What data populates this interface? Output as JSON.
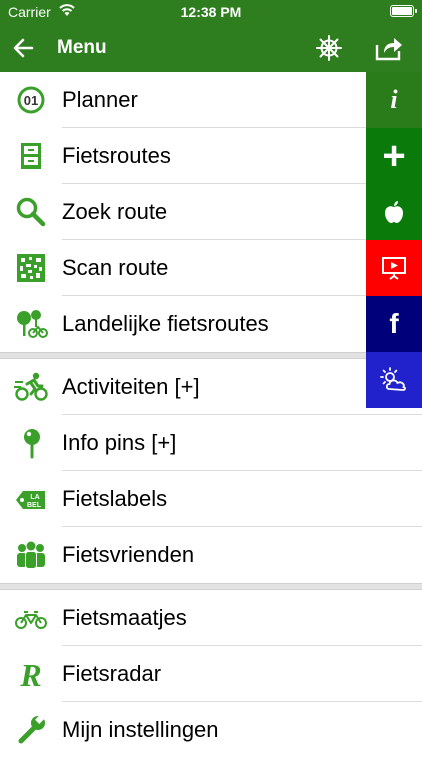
{
  "status": {
    "carrier": "Carrier",
    "time": "12:38 PM"
  },
  "header": {
    "title": "Menu"
  },
  "menu": {
    "items": [
      {
        "label": "Planner",
        "icon": "planner-01-icon"
      },
      {
        "label": "Fietsroutes",
        "icon": "cabinet-icon"
      },
      {
        "label": "Zoek route",
        "icon": "magnifier-icon"
      },
      {
        "label": "Scan route",
        "icon": "qr-code-icon"
      },
      {
        "label": "Landelijke fietsroutes",
        "icon": "trees-cyclist-icon"
      },
      {
        "label": "Activiteiten [+]",
        "icon": "cyclist-icon"
      },
      {
        "label": "Info pins [+]",
        "icon": "map-pin-icon"
      },
      {
        "label": "Fietslabels",
        "icon": "label-tag-icon"
      },
      {
        "label": "Fietsvrienden",
        "icon": "group-icon"
      },
      {
        "label": "Fietsmaatjes",
        "icon": "tandem-bike-icon"
      },
      {
        "label": "Fietsradar",
        "icon": "radar-r-icon"
      },
      {
        "label": "Mijn instellingen",
        "icon": "wrench-icon"
      }
    ]
  },
  "side_actions": {
    "colors": [
      "#2a7b1a",
      "#0a7a0a",
      "#0a7a0a",
      "#ff0000",
      "#00007a",
      "#2222cc"
    ],
    "info_glyph": "i",
    "add_glyph": "+",
    "facebook_glyph": "f"
  },
  "colors": {
    "brand_green": "#2e7d1e",
    "icon_green": "#3aa02a"
  }
}
